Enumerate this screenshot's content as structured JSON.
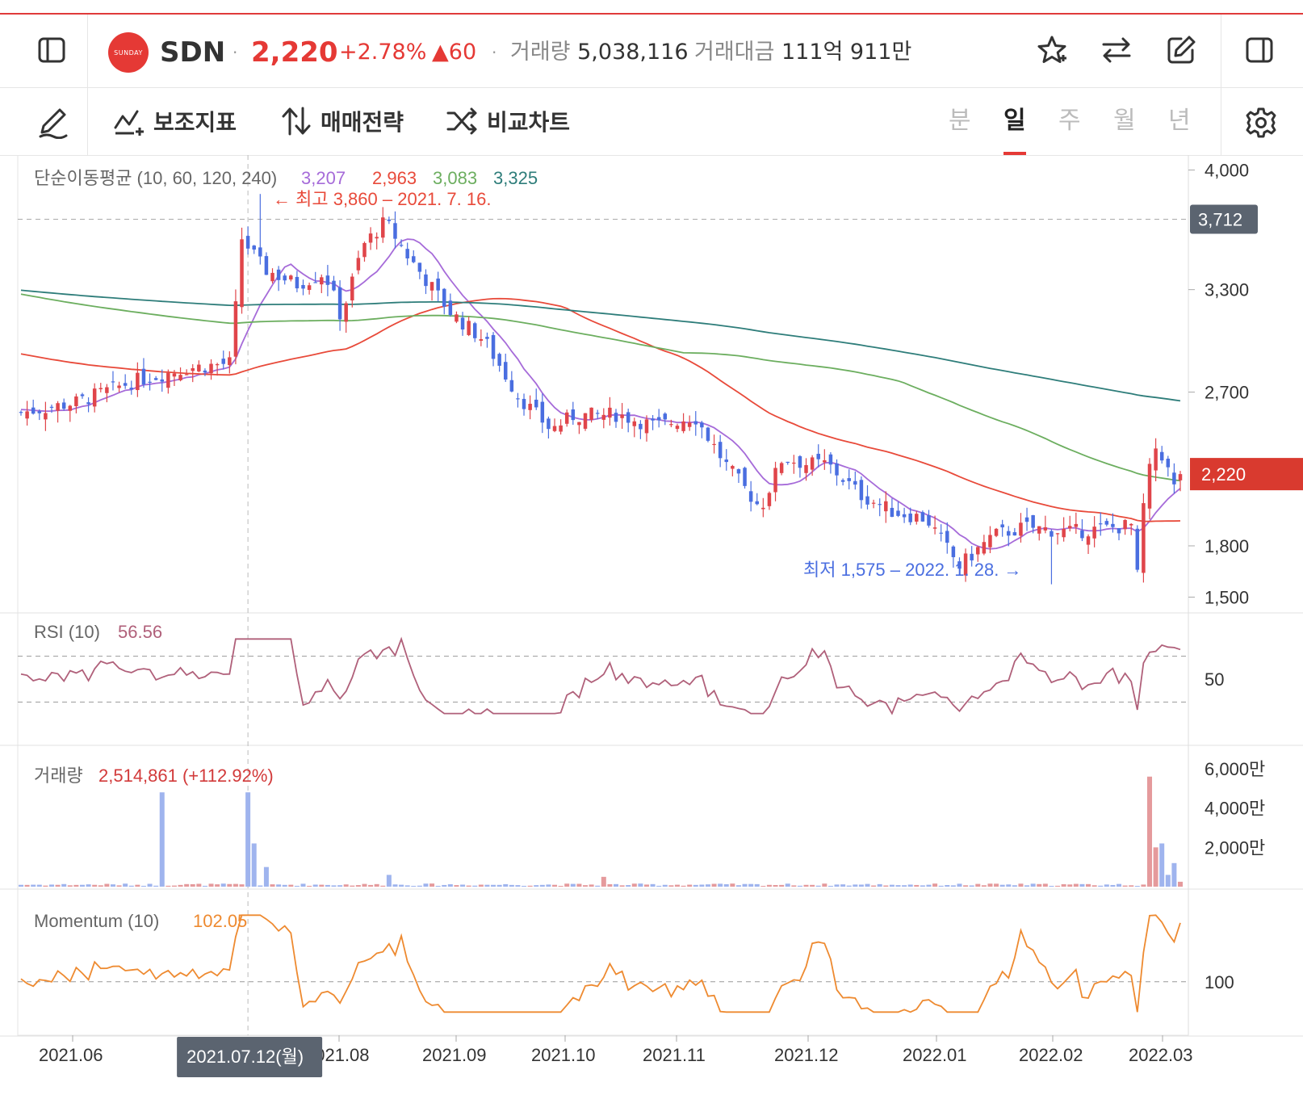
{
  "header": {
    "ticker": "SDN",
    "logo_text": "SUNDAY",
    "price": "2,220",
    "change_pct": "+2.78%",
    "change_abs": "▲60",
    "separator": "·",
    "volume_label": "거래량",
    "volume_value": "5,038,116",
    "amount_label": "거래대금",
    "amount_value": "111억 911만"
  },
  "toolbar": {
    "indicators_label": "보조지표",
    "strategy_label": "매매전략",
    "compare_label": "비교차트",
    "periods": [
      "분",
      "일",
      "주",
      "월",
      "년"
    ],
    "active_period": "일"
  },
  "colors": {
    "up": "#e0454a",
    "down": "#4a6ee0",
    "ma10": "#a66bd9",
    "ma60": "#e84a3a",
    "ma120": "#6cae5f",
    "ma240": "#2e7d7a",
    "rsi": "#b0607a",
    "momentum": "#ee8a30",
    "accent": "#e53935"
  },
  "chart_data": [
    {
      "type": "candlestick",
      "title": "단순이동평균 (10, 60, 120, 240)",
      "legend_values": [
        "3,207",
        "2,963",
        "3,083",
        "3,325"
      ],
      "series": [
        {
          "name": "10",
          "end_value": 2140
        },
        {
          "name": "60",
          "end_value": 1930
        },
        {
          "name": "120",
          "end_value": 2110
        },
        {
          "name": "240",
          "end_value": 2490
        }
      ],
      "y_ticks": [
        "4,000",
        "3,300",
        "2,700",
        "1,800",
        "1,500"
      ],
      "ylim": [
        1450,
        4050
      ],
      "x_ticks": [
        "2021.06",
        "2021.08",
        "2021.09",
        "2021.10",
        "2021.11",
        "2021.12",
        "2022.01",
        "2022.02",
        "2022.03"
      ],
      "crosshair_date": "2021.07.12(월)",
      "crosshair_price": "3,712",
      "current_price": "2,220",
      "high_annotation": "← 최고 3,860 – 2021. 7. 16.",
      "low_annotation": "최저 1,575 – 2022. 1. 28. →",
      "high": 3860,
      "low": 1575
    },
    {
      "type": "line",
      "title": "RSI (10)",
      "current_value": "56.56",
      "y_ticks": [
        "50"
      ],
      "ylim": [
        0,
        100
      ],
      "guides": [
        70,
        30
      ]
    },
    {
      "type": "bar",
      "title": "거래량",
      "current_value": "2,514,861 (+112.92%)",
      "y_ticks": [
        "6,000만",
        "4,000만",
        "2,000만"
      ],
      "ylim": [
        0,
        60000000
      ]
    },
    {
      "type": "line",
      "title": "Momentum (10)",
      "current_value": "102.05",
      "y_ticks": [
        "100"
      ]
    }
  ]
}
